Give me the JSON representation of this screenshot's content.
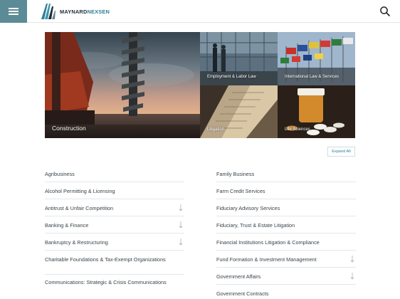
{
  "header": {
    "logo": {
      "part1": "MAYNARD",
      "part2": "NEXSEN"
    },
    "menu_icon": "hamburger-icon",
    "search_icon": "search-icon",
    "accent": "#5b8b96",
    "brand_teal": "#2d7e97"
  },
  "hero": {
    "tiles": [
      {
        "label": "Construction"
      },
      {
        "label": "Employment & Labor Law"
      },
      {
        "label": "International Law & Services"
      },
      {
        "label": "Litigation"
      },
      {
        "label": "Life Sciences"
      }
    ]
  },
  "expand_all_label": "Expand All",
  "practice_areas": {
    "left": [
      {
        "label": "Agribusiness",
        "expandable": false
      },
      {
        "label": "Alcohol Permitting & Licensing",
        "expandable": false
      },
      {
        "label": "Antitrust & Unfair Competition",
        "expandable": true
      },
      {
        "label": "Banking & Finance",
        "expandable": true
      },
      {
        "label": "Bankruptcy & Restructuring",
        "expandable": true
      },
      {
        "label": "Charitable Foundations & Tax-Exempt Organizations",
        "expandable": false
      },
      {
        "label": "Communications: Strategic & Crisis Communications",
        "expandable": false
      }
    ],
    "right": [
      {
        "label": "Family Business",
        "expandable": false
      },
      {
        "label": "Farm Credit Services",
        "expandable": false
      },
      {
        "label": "Fiduciary Advisory Services",
        "expandable": false
      },
      {
        "label": "Fiduciary, Trust & Estate Litigation",
        "expandable": false
      },
      {
        "label": "Financial Institutions Litigation & Compliance",
        "expandable": false
      },
      {
        "label": "Fund Formation & Investment Management",
        "expandable": true
      },
      {
        "label": "Government Affairs",
        "expandable": true
      },
      {
        "label": "Government Contracts",
        "expandable": false
      }
    ]
  }
}
